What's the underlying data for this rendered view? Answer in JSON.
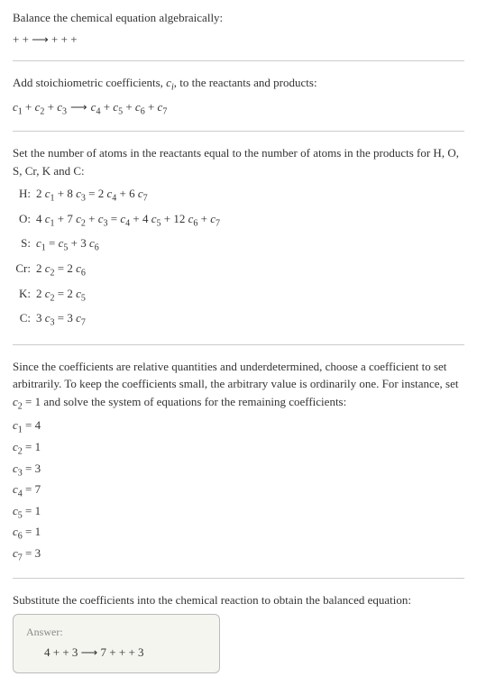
{
  "intro": {
    "title": "Balance the chemical equation algebraically:",
    "eq": " +  +   ⟶   +  +  + "
  },
  "stoich": {
    "text": "Add stoichiometric coefficients, ",
    "ci": "c",
    "ci_sub": "i",
    "text2": ", to the reactants and products:",
    "eq_parts": {
      "c1": "c",
      "s1": "1",
      "c2": "c",
      "s2": "2",
      "c3": "c",
      "s3": "3",
      "c4": "c",
      "s4": "4",
      "c5": "c",
      "s5": "5",
      "c6": "c",
      "s6": "6",
      "c7": "c",
      "s7": "7",
      "plus": "  + ",
      "arrow": "  ⟶  "
    }
  },
  "atoms": {
    "text": "Set the number of atoms in the reactants equal to the number of atoms in the products for H, O, S, Cr, K and C:",
    "rows": [
      {
        "label": "H:",
        "eq_tokens": [
          "2 ",
          "c",
          "1",
          " + 8 ",
          "c",
          "3",
          " = 2 ",
          "c",
          "4",
          " + 6 ",
          "c",
          "7"
        ]
      },
      {
        "label": "O:",
        "eq_tokens": [
          "4 ",
          "c",
          "1",
          " + 7 ",
          "c",
          "2",
          " + ",
          "c",
          "3",
          " = ",
          "c",
          "4",
          " + 4 ",
          "c",
          "5",
          " + 12 ",
          "c",
          "6",
          " + ",
          "c",
          "7"
        ]
      },
      {
        "label": "S:",
        "eq_tokens": [
          "",
          "c",
          "1",
          " = ",
          "c",
          "5",
          " + 3 ",
          "c",
          "6"
        ]
      },
      {
        "label": "Cr:",
        "eq_tokens": [
          "2 ",
          "c",
          "2",
          " = 2 ",
          "c",
          "6"
        ]
      },
      {
        "label": "K:",
        "eq_tokens": [
          "2 ",
          "c",
          "2",
          " = 2 ",
          "c",
          "5"
        ]
      },
      {
        "label": "C:",
        "eq_tokens": [
          "3 ",
          "c",
          "3",
          " = 3 ",
          "c",
          "7"
        ]
      }
    ]
  },
  "underdetermined": {
    "text_a": "Since the coefficients are relative quantities and underdetermined, choose a coefficient to set arbitrarily. To keep the coefficients small, the arbitrary value is ordinarily one. For instance, set ",
    "cv": "c",
    "cs": "2",
    "text_b": " = 1 and solve the system of equations for the remaining coefficients:",
    "coefs": [
      {
        "c": "c",
        "s": "1",
        "eq": " = 4"
      },
      {
        "c": "c",
        "s": "2",
        "eq": " = 1"
      },
      {
        "c": "c",
        "s": "3",
        "eq": " = 3"
      },
      {
        "c": "c",
        "s": "4",
        "eq": " = 7"
      },
      {
        "c": "c",
        "s": "5",
        "eq": " = 1"
      },
      {
        "c": "c",
        "s": "6",
        "eq": " = 1"
      },
      {
        "c": "c",
        "s": "7",
        "eq": " = 3"
      }
    ]
  },
  "substitute": {
    "text": "Substitute the coefficients into the chemical reaction to obtain the balanced equation:"
  },
  "answer": {
    "label": "Answer:",
    "eq": "4  +  + 3   ⟶  7  +  +  + 3 "
  }
}
